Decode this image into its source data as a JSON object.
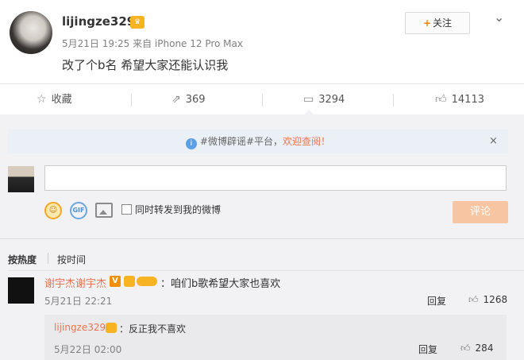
{
  "post": {
    "username": "lijingze329",
    "follow_label": "关注",
    "follow_plus": "+",
    "meta": "5月21日 19:25 来自 iPhone 12 Pro Max",
    "text": "改了个b名 希望大家还能认识我",
    "menu_icon": "chevron-down-icon"
  },
  "actions": {
    "favorite": "收藏",
    "repost": "369",
    "comment": "3294",
    "like": "14113"
  },
  "notice": {
    "prefix": "#微博辟谣#平台，",
    "highlight": "欢迎查阅！",
    "close": "×"
  },
  "composer": {
    "repost_label": "同时转发到我的微博",
    "submit_label": "评论",
    "gif_label": "GIF"
  },
  "sort": {
    "hot": "按热度",
    "time": "按时间"
  },
  "comment": {
    "name": "谢宇杰谢宇杰",
    "v": "V",
    "text": "：咱们b歌希望大家也喜欢",
    "time": "5月21日 22:21",
    "reply_label": "回复",
    "likes": "1268"
  },
  "reply": {
    "name": "lijingze329",
    "text": "：反正我不喜欢",
    "time": "5月22日 02:00",
    "reply_label": "回复",
    "likes": "284"
  },
  "colors": {
    "accent": "#ff8200",
    "name_link": "#eb7350",
    "panel_bg": "#f2f2f5",
    "submit_disabled": "#f7c5a2"
  }
}
